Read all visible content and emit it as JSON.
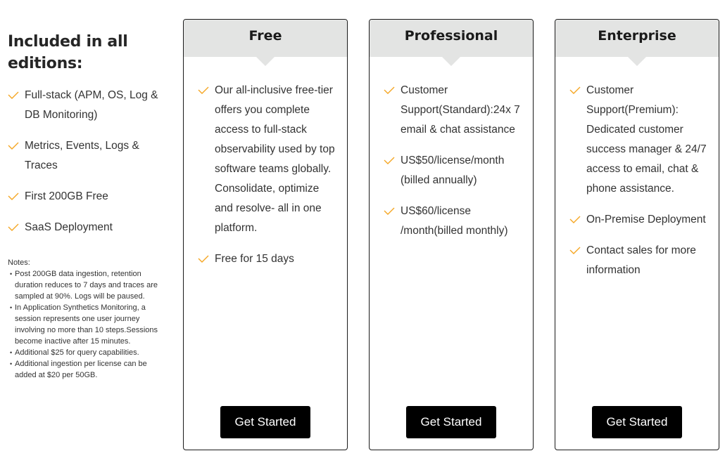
{
  "included": {
    "heading": "Included in all editions:",
    "items": [
      "Full-stack (APM, OS, Log & DB Monitoring)",
      "Metrics, Events, Logs & Traces",
      "First 200GB Free",
      "SaaS Deployment"
    ]
  },
  "notes": {
    "label": "Notes:",
    "items": [
      "Post 200GB data ingestion, retention duration reduces to 7 days and traces are sampled at 90%. Logs will be paused.",
      "In Application Synthetics Monitoring, a session represents one user journey involving no more than 10 steps.Sessions become inactive after 15 minutes.",
      "Additional $25 for query capabilities.",
      "Additional ingestion per license can be added at $20 per 50GB."
    ]
  },
  "check_icon": "checkmark-icon",
  "accent_color": "#f5a623",
  "plans": [
    {
      "name": "Free",
      "features": [
        "Our all-inclusive free-tier offers you complete access to full-stack observability used by top software teams globally. Consolidate, optimize and resolve- all in one platform.",
        "Free for 15 days"
      ],
      "button": "Get Started"
    },
    {
      "name": "Professional",
      "features": [
        "Customer Support(Standard):24x 7 email & chat assistance",
        "US$50/license/month (billed annually)",
        "US$60/license /month(billed monthly)"
      ],
      "button": "Get Started"
    },
    {
      "name": "Enterprise",
      "features": [
        "Customer Support(Premium): Dedicated customer success manager & 24/7 access to email, chat & phone assistance.",
        "On-Premise Deployment",
        "Contact sales for more information"
      ],
      "button": "Get Started"
    }
  ]
}
